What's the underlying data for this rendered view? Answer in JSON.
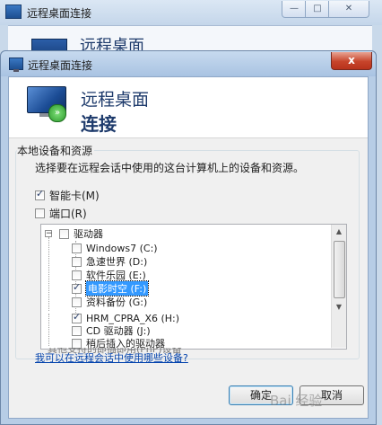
{
  "background_window": {
    "title": "远程桌面连接",
    "heading": "远程桌面",
    "controls": {
      "minimize": "—",
      "maximize": "□",
      "close": "✕"
    }
  },
  "dialog": {
    "title": "远程桌面连接",
    "close_glyph": "x",
    "heading_line1": "远程桌面",
    "heading_line2": "连接",
    "badge_glyph": "»"
  },
  "group": {
    "label": "本地设备和资源",
    "description": "选择要在远程会话中使用的这台计算机上的设备和资源。"
  },
  "checkboxes": [
    {
      "label": "智能卡(M)",
      "checked": true
    },
    {
      "label": "端口(R)",
      "checked": false
    }
  ],
  "tree": {
    "root": {
      "label": "驱动器",
      "expander": "⊟",
      "checked": false
    },
    "items": [
      {
        "label": "Windows7 (C:)",
        "checked": false
      },
      {
        "label": "急速世界 (D:)",
        "checked": false
      },
      {
        "label": "软件乐园 (E:)",
        "checked": false
      },
      {
        "label": "电影时空 (F:)",
        "checked": true,
        "selected": true
      },
      {
        "label": "资料备份 (G:)",
        "checked": false
      },
      {
        "label": "HRM_CPRA_X6 (H:)",
        "checked": true
      },
      {
        "label": "CD 驱动器 (J:)",
        "checked": false
      },
      {
        "label": "稍后插入的驱动器",
        "checked": false
      }
    ],
    "partial_next": "其他支持的即插即用(PnP)设备",
    "scroll_up": "▲",
    "scroll_down": "▼"
  },
  "help_link": "我可以在远程会话中使用哪些设备?",
  "buttons": {
    "ok": "确定",
    "cancel": "取消"
  },
  "watermark": "Bai 经验"
}
